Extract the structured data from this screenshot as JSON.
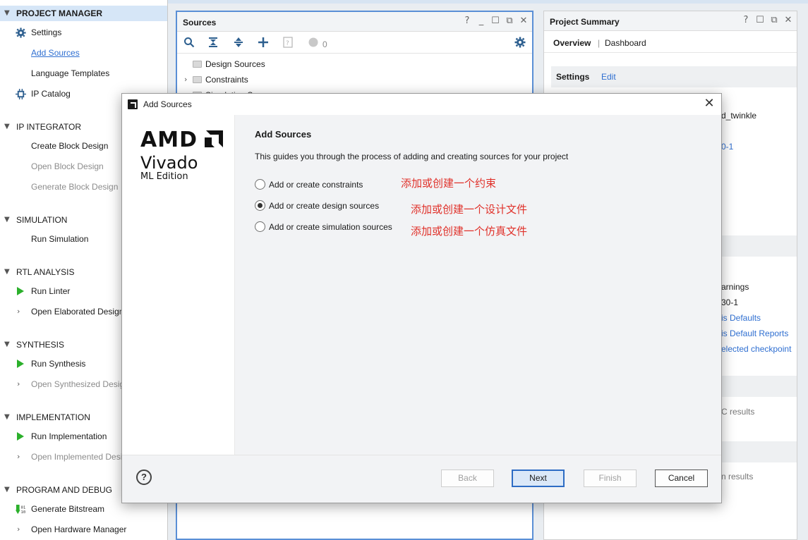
{
  "flow_navigator": {
    "sections": [
      {
        "title": "PROJECT MANAGER",
        "items": [
          {
            "label": "Settings",
            "icon": "gear-icon"
          },
          {
            "label": "Add Sources",
            "link": true
          },
          {
            "label": "Language Templates"
          },
          {
            "label": "IP Catalog",
            "icon": "ip-catalog-icon"
          }
        ]
      },
      {
        "title": "IP INTEGRATOR",
        "items": [
          {
            "label": "Create Block Design"
          },
          {
            "label": "Open Block Design",
            "disabled": true
          },
          {
            "label": "Generate Block Design",
            "disabled": true
          }
        ]
      },
      {
        "title": "SIMULATION",
        "items": [
          {
            "label": "Run Simulation"
          }
        ]
      },
      {
        "title": "RTL ANALYSIS",
        "items": [
          {
            "label": "Run Linter",
            "icon": "play-icon"
          },
          {
            "label": "Open Elaborated Design"
          }
        ]
      },
      {
        "title": "SYNTHESIS",
        "items": [
          {
            "label": "Run Synthesis",
            "icon": "play-icon"
          },
          {
            "label": "Open Synthesized Design",
            "disabled": true
          }
        ]
      },
      {
        "title": "IMPLEMENTATION",
        "items": [
          {
            "label": "Run Implementation",
            "icon": "play-icon"
          },
          {
            "label": "Open Implemented Design",
            "disabled": true
          }
        ]
      },
      {
        "title": "PROGRAM AND DEBUG",
        "items": [
          {
            "label": "Generate Bitstream",
            "icon": "bitstream-icon"
          },
          {
            "label": "Open Hardware Manager"
          }
        ]
      }
    ]
  },
  "sources_panel": {
    "title": "Sources",
    "controls": [
      "?",
      "_",
      "☐",
      "⧉",
      "✕"
    ],
    "badge_count": "0",
    "tree": [
      "Design Sources",
      "Constraints",
      "Simulation Sources"
    ]
  },
  "summary_panel": {
    "title": "Project Summary",
    "controls": [
      "?",
      "☐",
      "⧉",
      "✕"
    ],
    "tabs": [
      "Overview",
      "Dashboard"
    ],
    "settings_label": "Settings",
    "edit_label": "Edit",
    "partial_texts": [
      "d_twinkle",
      "0-1",
      "arnings",
      "30-1",
      "is Defaults",
      "is Default Reports",
      "elected checkpoint",
      "C results",
      "n results"
    ]
  },
  "dialog": {
    "title": "Add Sources",
    "brand": {
      "amd": "AMD",
      "vivado": "Vivado",
      "edition": "ML Edition"
    },
    "heading": "Add Sources",
    "description": "This guides you through the process of adding and creating sources for your project",
    "options": [
      {
        "label": "Add or create constraints",
        "checked": false,
        "annotation": "添加或创建一个约束"
      },
      {
        "label": "Add or create design sources",
        "checked": true,
        "annotation": "添加或创建一个设计文件"
      },
      {
        "label": "Add or create simulation sources",
        "checked": false,
        "annotation": "添加或创建一个仿真文件"
      }
    ],
    "buttons": {
      "help": "?",
      "back": "Back",
      "next": "Next",
      "finish": "Finish",
      "cancel": "Cancel"
    }
  },
  "colors": {
    "accent": "#2d6cc4",
    "annotation": "#e0312a",
    "link": "#2f6fd1",
    "run": "#2bb02b"
  }
}
